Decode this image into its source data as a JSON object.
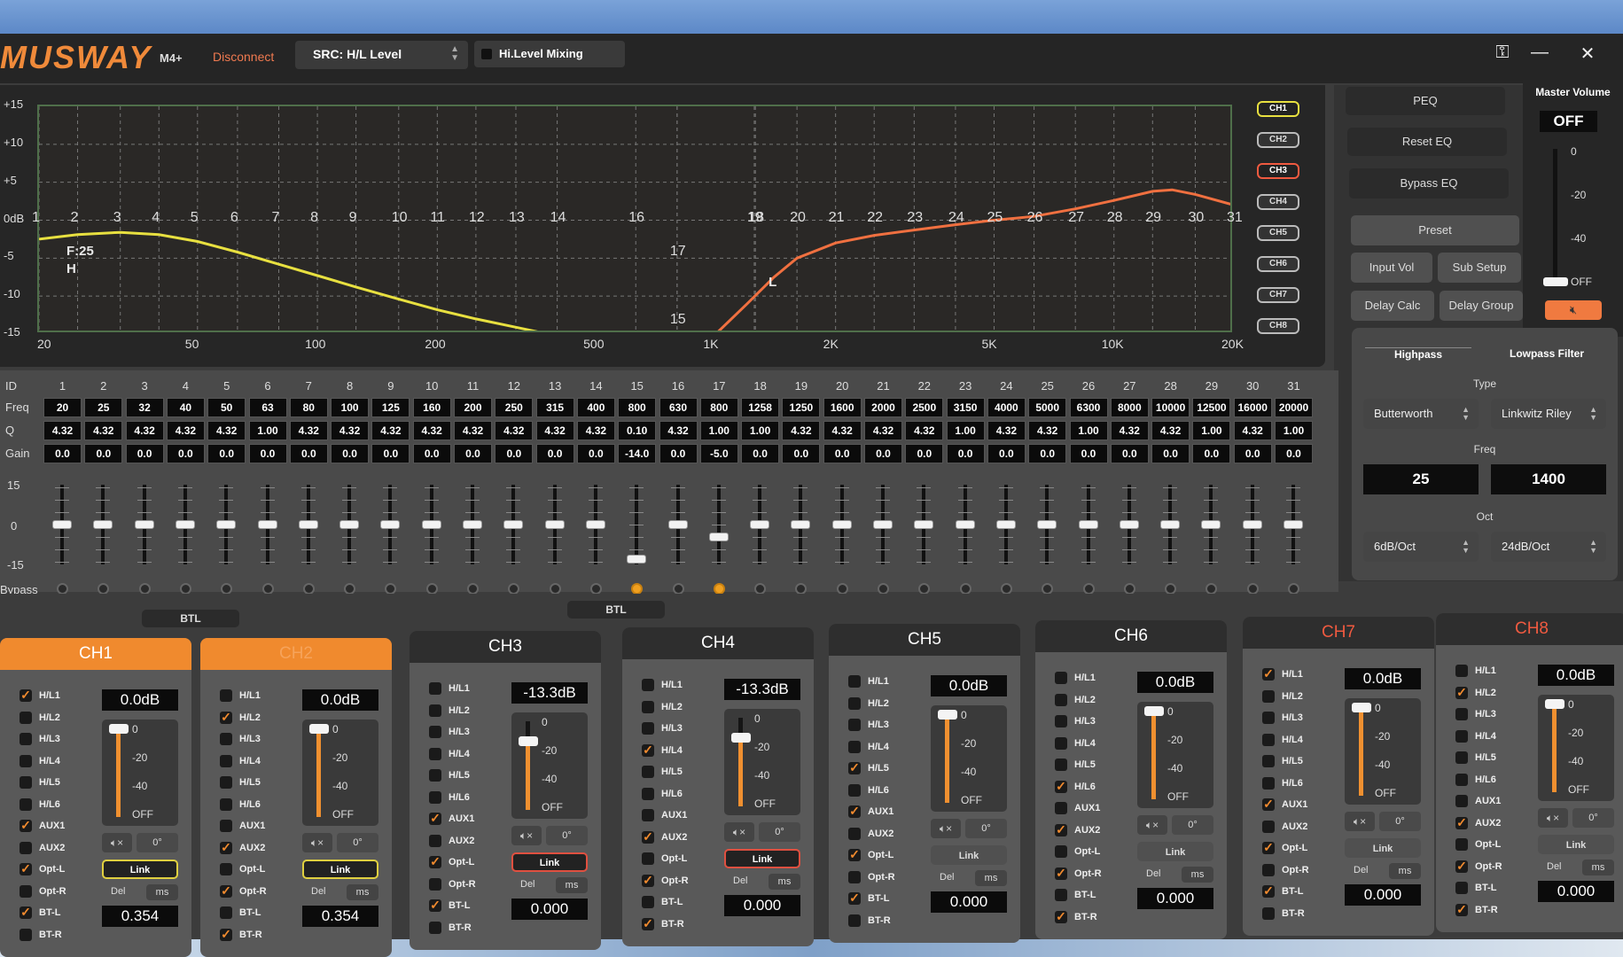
{
  "header": {
    "logo": "MUSWAY",
    "model": "M4+",
    "connection": "Disconnect",
    "source_select": "SRC: H/L Level",
    "hi_level_mixing_label": "Hi.Level Mixing",
    "hi_level_mixing_checked": false,
    "icons": [
      "key-icon",
      "minimize-icon",
      "close-icon"
    ]
  },
  "eq_graph": {
    "y_ticks": [
      "+15",
      "+10",
      "+5",
      "0dB",
      "-5",
      "-10",
      "-15"
    ],
    "x_ticks": [
      {
        "label": "20",
        "freq": 20
      },
      {
        "label": "50",
        "freq": 50
      },
      {
        "label": "100",
        "freq": 100
      },
      {
        "label": "200",
        "freq": 200
      },
      {
        "label": "500",
        "freq": 500
      },
      {
        "label": "1K",
        "freq": 1000
      },
      {
        "label": "2K",
        "freq": 2000
      },
      {
        "label": "5K",
        "freq": 5000
      },
      {
        "label": "10K",
        "freq": 10000
      },
      {
        "label": "20K",
        "freq": 20000
      }
    ],
    "hp_annotation": "F:25",
    "hp_annotation2": "H",
    "lp_annotation": "L",
    "curves": [
      {
        "name": "ch1-curve",
        "color": "#e8e040",
        "points": [
          [
            20,
            -2.5
          ],
          [
            25,
            -1.9
          ],
          [
            32,
            -1.6
          ],
          [
            40,
            -1.9
          ],
          [
            50,
            -2.8
          ],
          [
            63,
            -4.2
          ],
          [
            80,
            -5.8
          ],
          [
            100,
            -7.3
          ],
          [
            125,
            -8.8
          ],
          [
            160,
            -10.4
          ],
          [
            200,
            -11.8
          ],
          [
            250,
            -13
          ],
          [
            315,
            -14.1
          ],
          [
            380,
            -15
          ]
        ]
      },
      {
        "name": "ch3-curve",
        "color": "#f07040",
        "points": [
          [
            1000,
            -15
          ],
          [
            1200,
            -11
          ],
          [
            1400,
            -7.5
          ],
          [
            1600,
            -5
          ],
          [
            2000,
            -3
          ],
          [
            2500,
            -2
          ],
          [
            3150,
            -1.3
          ],
          [
            4000,
            -0.6
          ],
          [
            5000,
            0
          ],
          [
            6300,
            0.5
          ],
          [
            8000,
            1.5
          ],
          [
            10000,
            2.6
          ],
          [
            12500,
            3.8
          ],
          [
            14000,
            4
          ],
          [
            16000,
            3.4
          ],
          [
            20000,
            2
          ]
        ]
      }
    ],
    "channel_buttons": [
      {
        "label": "CH1",
        "state": "selected-yellow"
      },
      {
        "label": "CH2",
        "state": "normal"
      },
      {
        "label": "CH3",
        "state": "selected-red"
      },
      {
        "label": "CH4",
        "state": "normal"
      },
      {
        "label": "CH5",
        "state": "normal"
      },
      {
        "label": "CH6",
        "state": "normal"
      },
      {
        "label": "CH7",
        "state": "normal"
      },
      {
        "label": "CH8",
        "state": "normal"
      }
    ]
  },
  "peq_table": {
    "row_labels": {
      "id": "ID",
      "freq": "Freq",
      "q": "Q",
      "gain": "Gain",
      "bypass": "Bypass"
    },
    "fader_scale": [
      "15",
      "0",
      "-15"
    ],
    "bands": [
      {
        "id": "1",
        "freq": "20",
        "q": "4.32",
        "gain": "0.0",
        "bypass": false
      },
      {
        "id": "2",
        "freq": "25",
        "q": "4.32",
        "gain": "0.0",
        "bypass": false
      },
      {
        "id": "3",
        "freq": "32",
        "q": "4.32",
        "gain": "0.0",
        "bypass": false
      },
      {
        "id": "4",
        "freq": "40",
        "q": "4.32",
        "gain": "0.0",
        "bypass": false
      },
      {
        "id": "5",
        "freq": "50",
        "q": "4.32",
        "gain": "0.0",
        "bypass": false
      },
      {
        "id": "6",
        "freq": "63",
        "q": "1.00",
        "gain": "0.0",
        "bypass": false
      },
      {
        "id": "7",
        "freq": "80",
        "q": "4.32",
        "gain": "0.0",
        "bypass": false
      },
      {
        "id": "8",
        "freq": "100",
        "q": "4.32",
        "gain": "0.0",
        "bypass": false
      },
      {
        "id": "9",
        "freq": "125",
        "q": "4.32",
        "gain": "0.0",
        "bypass": false
      },
      {
        "id": "10",
        "freq": "160",
        "q": "4.32",
        "gain": "0.0",
        "bypass": false
      },
      {
        "id": "11",
        "freq": "200",
        "q": "4.32",
        "gain": "0.0",
        "bypass": false
      },
      {
        "id": "12",
        "freq": "250",
        "q": "4.32",
        "gain": "0.0",
        "bypass": false
      },
      {
        "id": "13",
        "freq": "315",
        "q": "4.32",
        "gain": "0.0",
        "bypass": false
      },
      {
        "id": "14",
        "freq": "400",
        "q": "4.32",
        "gain": "0.0",
        "bypass": false
      },
      {
        "id": "15",
        "freq": "800",
        "q": "0.10",
        "gain": "-14.0",
        "bypass": true
      },
      {
        "id": "16",
        "freq": "630",
        "q": "4.32",
        "gain": "0.0",
        "bypass": false
      },
      {
        "id": "17",
        "freq": "800",
        "q": "1.00",
        "gain": "-5.0",
        "bypass": true
      },
      {
        "id": "18",
        "freq": "1258",
        "q": "1.00",
        "gain": "0.0",
        "bypass": false
      },
      {
        "id": "19",
        "freq": "1250",
        "q": "4.32",
        "gain": "0.0",
        "bypass": false
      },
      {
        "id": "20",
        "freq": "1600",
        "q": "4.32",
        "gain": "0.0",
        "bypass": false
      },
      {
        "id": "21",
        "freq": "2000",
        "q": "4.32",
        "gain": "0.0",
        "bypass": false
      },
      {
        "id": "22",
        "freq": "2500",
        "q": "4.32",
        "gain": "0.0",
        "bypass": false
      },
      {
        "id": "23",
        "freq": "3150",
        "q": "1.00",
        "gain": "0.0",
        "bypass": false
      },
      {
        "id": "24",
        "freq": "4000",
        "q": "4.32",
        "gain": "0.0",
        "bypass": false
      },
      {
        "id": "25",
        "freq": "5000",
        "q": "4.32",
        "gain": "0.0",
        "bypass": false
      },
      {
        "id": "26",
        "freq": "6300",
        "q": "1.00",
        "gain": "0.0",
        "bypass": false
      },
      {
        "id": "27",
        "freq": "8000",
        "q": "4.32",
        "gain": "0.0",
        "bypass": false
      },
      {
        "id": "28",
        "freq": "10000",
        "q": "4.32",
        "gain": "0.0",
        "bypass": false
      },
      {
        "id": "29",
        "freq": "12500",
        "q": "1.00",
        "gain": "0.0",
        "bypass": false
      },
      {
        "id": "30",
        "freq": "16000",
        "q": "4.32",
        "gain": "0.0",
        "bypass": false
      },
      {
        "id": "31",
        "freq": "20000",
        "q": "1.00",
        "gain": "0.0",
        "bypass": false
      }
    ]
  },
  "right_panel": {
    "peq": "PEQ",
    "reset_eq": "Reset EQ",
    "bypass_eq": "Bypass EQ",
    "preset": "Preset",
    "input_vol": "Input Vol",
    "sub_setup": "Sub Setup",
    "delay_calc": "Delay Calc",
    "delay_group": "Delay Group",
    "master_volume": {
      "label": "Master Volume",
      "value": "OFF",
      "scale": [
        "0",
        "-20",
        "-40",
        "OFF"
      ],
      "level_fraction": 0,
      "muted": true
    },
    "filter": {
      "highpass_tab": "Highpass",
      "lowpass_tab": "Lowpass Filter",
      "type_label": "Type",
      "hp_type": "Butterworth",
      "lp_type": "Linkwitz Riley",
      "freq_label": "Freq",
      "hp_freq": "25",
      "lp_freq": "1400",
      "oct_label": "Oct",
      "hp_oct": "6dB/Oct",
      "lp_oct": "24dB/Oct"
    }
  },
  "btl_labels": [
    "BTL",
    "BTL"
  ],
  "strips": {
    "inputs": [
      "H/L1",
      "H/L2",
      "H/L3",
      "H/L4",
      "H/L5",
      "H/L6",
      "AUX1",
      "AUX2",
      "Opt-L",
      "Opt-R",
      "BT-L",
      "BT-R"
    ],
    "scale": [
      "0",
      "-20",
      "-40",
      "OFF"
    ],
    "phase": "0°",
    "link": "Link",
    "del": "Del",
    "ms": "ms",
    "channels": [
      {
        "name": "CH1",
        "header": "orange",
        "volume": "0.0dB",
        "level_db": 0,
        "checked": [
          "H/L1",
          "AUX1",
          "Opt-L",
          "BT-L"
        ],
        "link": "y",
        "delay": "0.354"
      },
      {
        "name": "CH2",
        "header": "orange ghost",
        "volume": "0.0dB",
        "level_db": 0,
        "checked": [
          "H/L2",
          "AUX2",
          "Opt-R",
          "BT-R"
        ],
        "link": "y",
        "delay": "0.354"
      },
      {
        "name": "CH3",
        "header": "",
        "volume": "-13.3dB",
        "level_db": -13.3,
        "checked": [
          "AUX1",
          "Opt-L",
          "BT-L"
        ],
        "link": "r",
        "delay": "0.000"
      },
      {
        "name": "CH4",
        "header": "",
        "volume": "-13.3dB",
        "level_db": -13.3,
        "checked": [
          "H/L4",
          "AUX2",
          "Opt-R",
          "BT-R"
        ],
        "link": "r",
        "delay": "0.000"
      },
      {
        "name": "CH5",
        "header": "",
        "volume": "0.0dB",
        "level_db": 0,
        "checked": [
          "H/L5",
          "AUX1",
          "Opt-L",
          "BT-L"
        ],
        "link": "",
        "delay": "0.000"
      },
      {
        "name": "CH6",
        "header": "",
        "volume": "0.0dB",
        "level_db": 0,
        "checked": [
          "H/L6",
          "AUX2",
          "Opt-R",
          "BT-R"
        ],
        "link": "",
        "delay": "0.000"
      },
      {
        "name": "CH7",
        "header": "red",
        "volume": "0.0dB",
        "level_db": 0,
        "checked": [
          "H/L1",
          "AUX1",
          "Opt-L",
          "BT-L"
        ],
        "link": "",
        "delay": "0.000"
      },
      {
        "name": "CH8",
        "header": "red",
        "volume": "0.0dB",
        "level_db": 0,
        "checked": [
          "H/L2",
          "AUX2",
          "Opt-R",
          "BT-R"
        ],
        "link": "",
        "delay": "0.000"
      }
    ]
  },
  "colors": {
    "accent": "#f08a2e",
    "warning": "#f05a40",
    "link_yellow": "#e0d040"
  }
}
